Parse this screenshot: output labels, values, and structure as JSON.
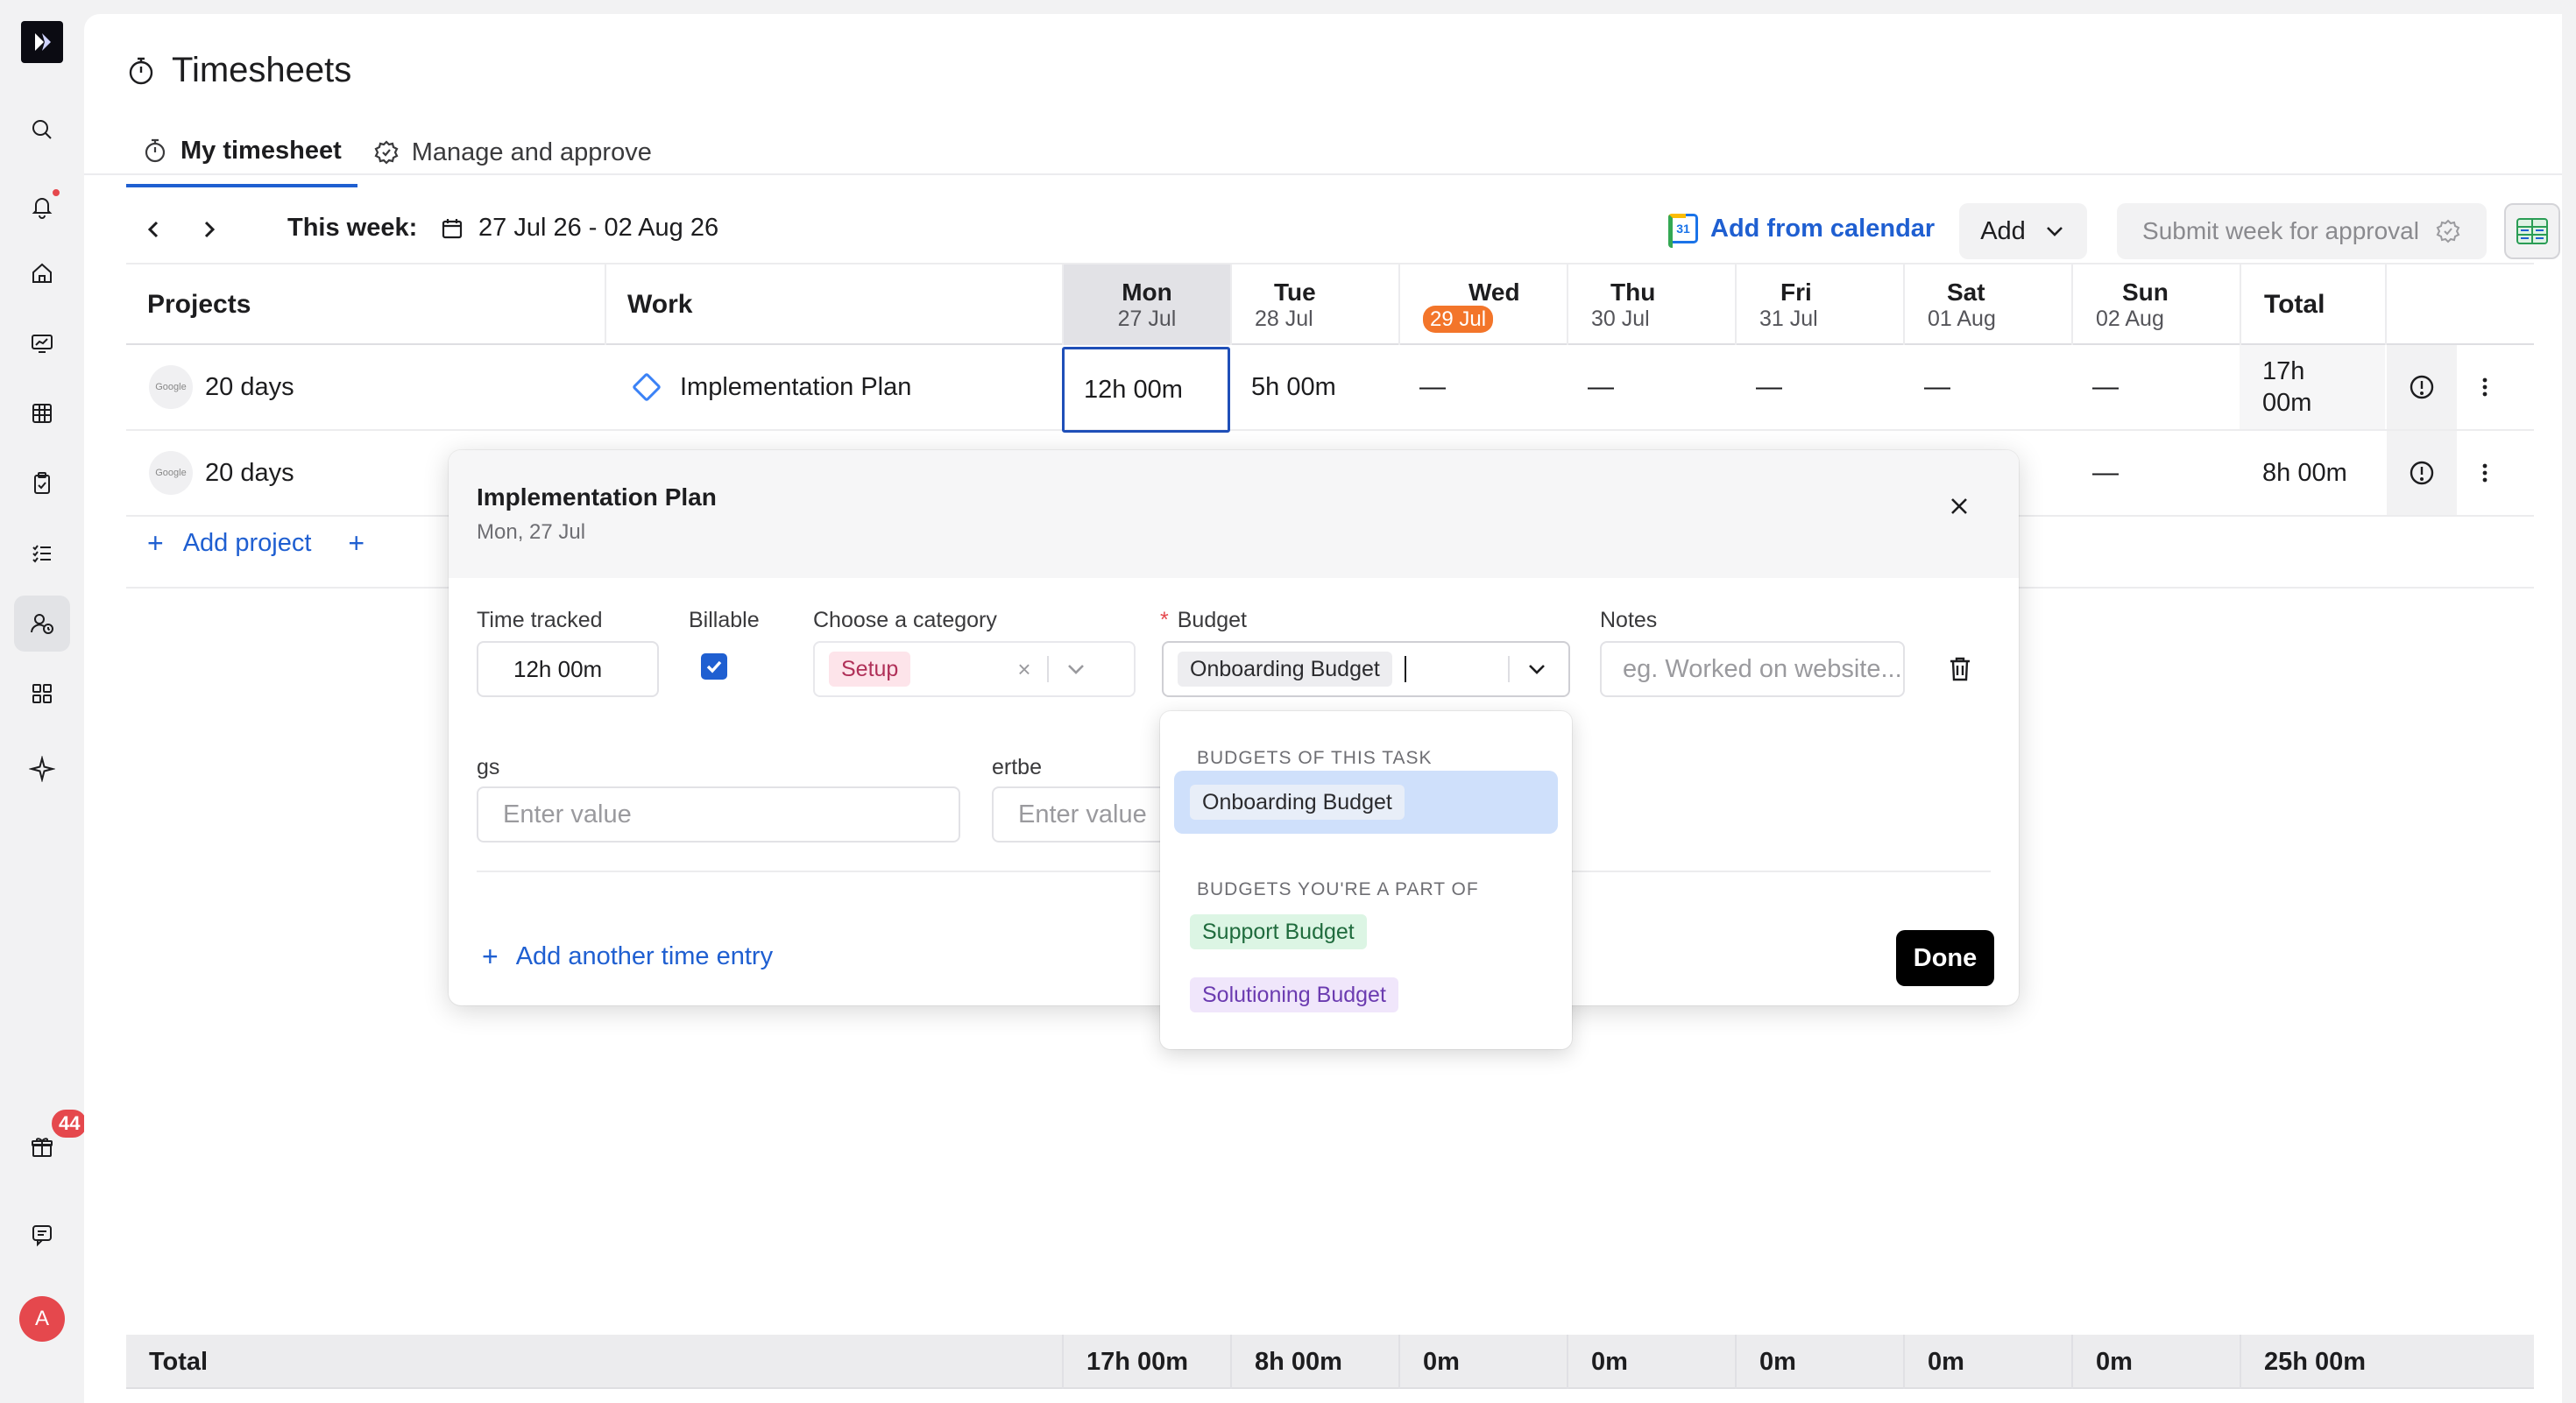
{
  "sidebar": {
    "logo_icon": "brand-logo",
    "notification_badge_color": "#e5484d",
    "gift_badge_count": "44",
    "avatar_initial": "A"
  },
  "page": {
    "title": "Timesheets",
    "tabs": [
      {
        "label": "My timesheet",
        "icon": "stopwatch-icon",
        "active": true
      },
      {
        "label": "Manage and approve",
        "icon": "gear-check-icon",
        "active": false
      }
    ]
  },
  "toolbar": {
    "week_label": "This week:",
    "week_range": "27 Jul 26 - 02 Aug 26",
    "add_from_calendar": "Add from calendar",
    "add_label": "Add",
    "submit_label": "Submit week for approval"
  },
  "table": {
    "headers": {
      "projects": "Projects",
      "work": "Work",
      "total": "Total"
    },
    "days": [
      {
        "name": "Mon",
        "date": "27 Jul",
        "selected": true
      },
      {
        "name": "Tue",
        "date": "28 Jul"
      },
      {
        "name": "Wed",
        "date": "29 Jul",
        "today": true
      },
      {
        "name": "Thu",
        "date": "30 Jul"
      },
      {
        "name": "Fri",
        "date": "31 Jul"
      },
      {
        "name": "Sat",
        "date": "01 Aug"
      },
      {
        "name": "Sun",
        "date": "02 Aug"
      }
    ],
    "rows": [
      {
        "project_logo": "Google",
        "project": "20 days",
        "work": "Implementation Plan",
        "values": [
          "12h 00m",
          "5h 00m",
          "—",
          "—",
          "—",
          "—",
          "—"
        ],
        "total_line1": "17h",
        "total_line2": "00m"
      },
      {
        "project_logo": "Google",
        "project": "20 days",
        "values": [
          "—",
          "—"
        ],
        "total": "8h 00m"
      }
    ],
    "add_project": "Add project",
    "add_second_plus": "+",
    "totals": {
      "label": "Total",
      "values": [
        "17h 00m",
        "8h 00m",
        "0m",
        "0m",
        "0m",
        "0m",
        "0m"
      ],
      "grand_total": "25h 00m"
    }
  },
  "popover": {
    "title": "Implementation Plan",
    "subtitle": "Mon, 27 Jul",
    "time_tracked_label": "Time tracked",
    "time_tracked_value": "12h 00m",
    "billable_label": "Billable",
    "billable_checked": true,
    "category_label": "Choose a category",
    "category_value": "Setup",
    "category_clear": "×",
    "budget_label": "Budget",
    "budget_required": "*",
    "budget_value": "Onboarding Budget",
    "notes_label": "Notes",
    "notes_placeholder": "eg. Worked on website...",
    "custom_field_1_label": "gs",
    "custom_field_1_placeholder": "Enter value",
    "custom_field_2_label": "ertbe",
    "custom_field_2_placeholder": "Enter value",
    "add_another": "Add another time entry",
    "done": "Done"
  },
  "budget_dropdown": {
    "group_1": "BUDGETS OF THIS TASK",
    "group_1_items": [
      "Onboarding Budget"
    ],
    "group_2": "BUDGETS YOU'RE A PART OF",
    "group_2_items": [
      "Support Budget",
      "Solutioning Budget"
    ]
  }
}
